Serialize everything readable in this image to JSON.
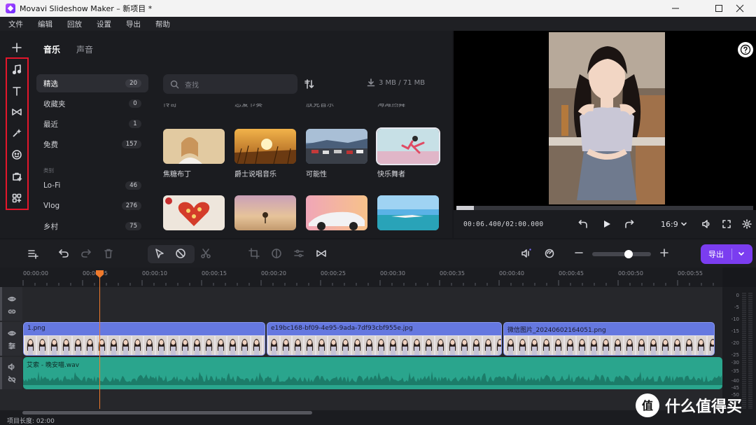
{
  "window": {
    "title": "Movavi Slideshow Maker – 新项目 *"
  },
  "menu": [
    "文件",
    "编辑",
    "回放",
    "设置",
    "导出",
    "帮助"
  ],
  "rail": {
    "icons": [
      "add-icon",
      "music-icon",
      "text-icon",
      "transition-icon",
      "effects-icon",
      "sticker-icon",
      "media-store-icon",
      "more-apps-icon"
    ]
  },
  "library": {
    "tabs": [
      "音乐",
      "声音"
    ],
    "categories": [
      {
        "label": "精选",
        "count": "20"
      },
      {
        "label": "收藏夹",
        "count": "0"
      },
      {
        "label": "最近",
        "count": "1"
      },
      {
        "label": "免费",
        "count": "157"
      },
      {
        "label": "Lo-Fi",
        "count": "46"
      },
      {
        "label": "Vlog",
        "count": "276"
      },
      {
        "label": "乡村",
        "count": "75"
      }
    ],
    "section_label": "类别",
    "search_placeholder": "查找",
    "storage": "3 MB / 71 MB",
    "prev_row_labels": [
      "传奇",
      "恋爱节奏",
      "放克音乐",
      "海滩热舞"
    ],
    "tracks": [
      {
        "label": "焦糖布丁"
      },
      {
        "label": "爵士说唱音乐"
      },
      {
        "label": "可能性"
      },
      {
        "label": "快乐舞者"
      }
    ]
  },
  "player": {
    "timecode": "00:06.400/02:00.000",
    "aspect": "16:9",
    "progress": 0.06
  },
  "toolbar": {
    "export": "导出",
    "zoom": 0.62
  },
  "ruler": {
    "ticks": [
      "00:00:00",
      "00:00:05",
      "00:00:10",
      "00:00:15",
      "00:00:20",
      "00:00:25",
      "00:00:30",
      "00:00:35",
      "00:00:40",
      "00:00:45",
      "00:00:50",
      "00:00:55"
    ]
  },
  "clips": {
    "video": [
      "1.png",
      "e19bc168-bf09-4e95-9ada-7df93cbf955e.jpg",
      "微信图片_20240602164051.png"
    ],
    "audio": "艾索 - 晚安喵.wav"
  },
  "meter": {
    "labels": [
      "0",
      "-5",
      "-10",
      "-15",
      "-20",
      "-25",
      "-30",
      "-35",
      "-40",
      "-45",
      "-50"
    ]
  },
  "status": {
    "duration": "项目长度: 02:00"
  },
  "watermark": {
    "text": "什么值得买"
  }
}
